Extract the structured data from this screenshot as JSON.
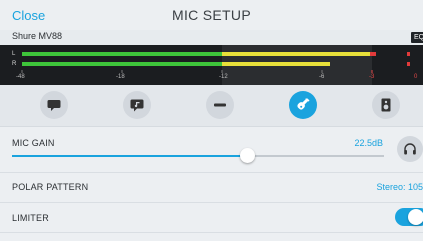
{
  "header": {
    "close_label": "Close",
    "title": "MIC SETUP"
  },
  "device": {
    "name": "Shure MV88",
    "eq_badge": "EQ"
  },
  "meter": {
    "channels": [
      "L",
      "R"
    ],
    "scale_labels": [
      "-48",
      "-18",
      "-12",
      "-6",
      "-3",
      "0"
    ],
    "levels": {
      "L": -3,
      "R": -6
    },
    "colors": {
      "green": "#3ec43a",
      "yellow": "#e8e03a",
      "red": "#e23b3b"
    }
  },
  "icons": [
    {
      "name": "speech-bubble-icon",
      "active": false
    },
    {
      "name": "music-note-bubble-icon",
      "active": false
    },
    {
      "name": "flat-eq-icon",
      "active": false
    },
    {
      "name": "guitar-icon",
      "active": true
    },
    {
      "name": "speaker-icon",
      "active": false
    }
  ],
  "gain": {
    "label": "MIC GAIN",
    "value": "22.5dB",
    "level": 0.63
  },
  "polar": {
    "label": "POLAR PATTERN",
    "value": "Stereo: 105"
  },
  "limiter": {
    "label": "LIMITER",
    "on": true
  },
  "colors": {
    "accent": "#1aa3de",
    "background": "#eceff2"
  }
}
